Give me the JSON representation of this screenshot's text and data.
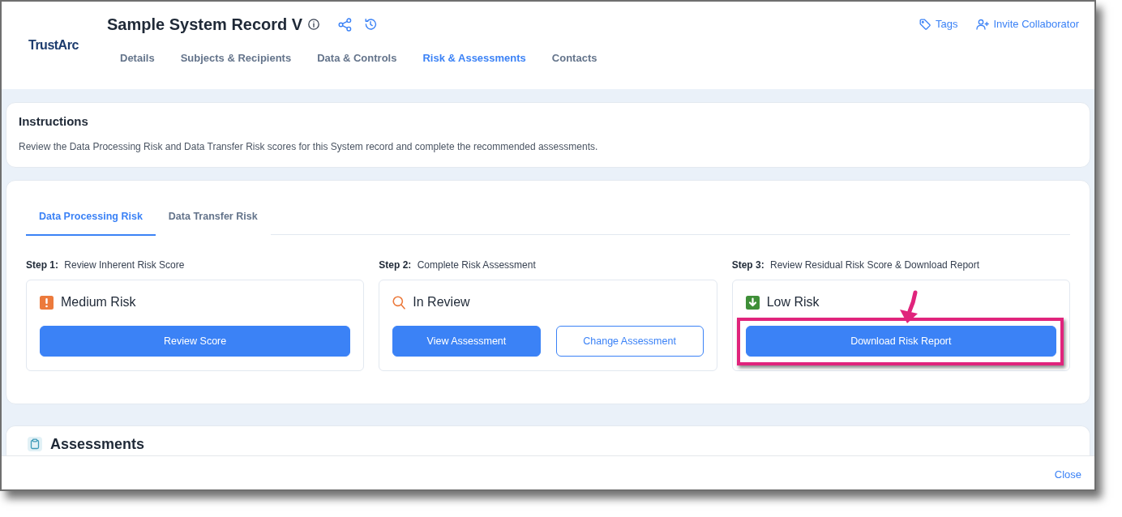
{
  "window": {
    "logo": "TrustArc",
    "title": "Sample System Record V",
    "actions": [
      {
        "kind": "tags",
        "label": "Tags"
      },
      {
        "kind": "invite",
        "label": "Invite Collaborator"
      }
    ]
  },
  "nav_tabs": [
    {
      "label": "Details",
      "selected": false
    },
    {
      "label": "Subjects & Recipients",
      "selected": false
    },
    {
      "label": "Data & Controls",
      "selected": false
    },
    {
      "label": "Risk & Assessments",
      "selected": true
    },
    {
      "label": "Contacts",
      "selected": false
    }
  ],
  "instructions": {
    "title": "Instructions",
    "text": "Review the Data Processing Risk and Data Transfer Risk scores for this System record and complete the recommended assessments."
  },
  "risk_tabs": [
    {
      "label": "Data Processing Risk",
      "selected": true
    },
    {
      "label": "Data Transfer Risk",
      "selected": false
    }
  ],
  "steps": [
    {
      "step": "**Step 1:** Review Inherent Risk Score",
      "status": {
        "kind": "medium",
        "label": "Medium Risk"
      },
      "buttons": [
        {
          "kind": "primary",
          "label": "Review Score",
          "highlighted": false
        }
      ]
    },
    {
      "step": "**Step 2:** Complete Risk Assessment",
      "status": {
        "kind": "in_review",
        "label": "In Review"
      },
      "buttons": [
        {
          "kind": "primary",
          "label": "View Assessment",
          "highlighted": false
        },
        {
          "kind": "outline",
          "label": "Change Assessment",
          "highlighted": false
        }
      ]
    },
    {
      "step": "**Step 3:** Review Residual Risk Score & Download Report",
      "status": {
        "kind": "low",
        "label": "Low Risk"
      },
      "buttons": [
        {
          "kind": "primary",
          "label": "Download Risk Report",
          "highlighted": true
        }
      ]
    }
  ],
  "assessments": {
    "title": "Assessments"
  },
  "footer": {
    "close": "Close"
  }
}
